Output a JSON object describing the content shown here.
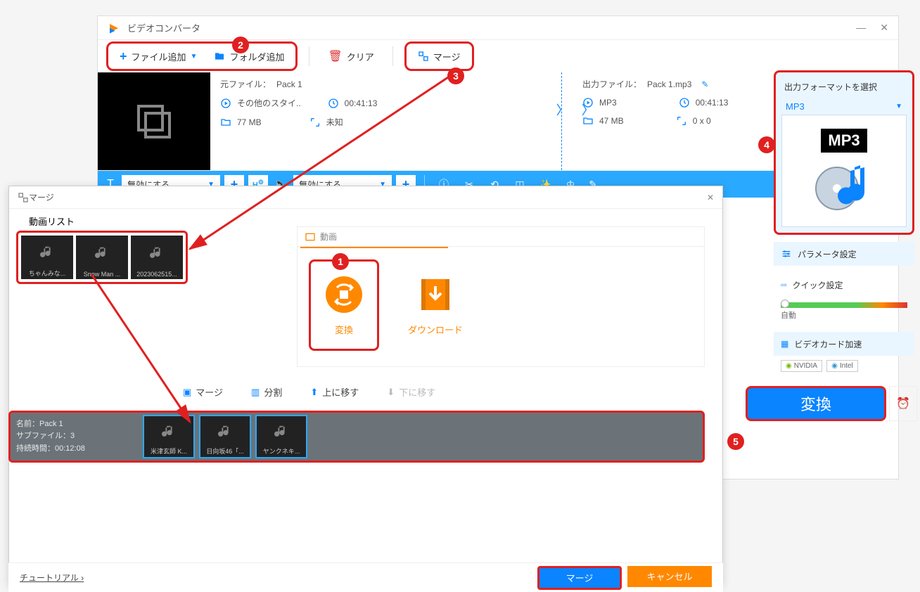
{
  "app": {
    "title": "ビデオコンバータ"
  },
  "toolbar": {
    "add_file": "ファイル追加",
    "add_folder": "フォルダ追加",
    "clear": "クリア",
    "merge": "マージ"
  },
  "source": {
    "label": "元ファイル：",
    "name": "Pack 1",
    "style": "その他のスタイ..",
    "duration": "00:41:13",
    "size": "77 MB",
    "resolution": "未知"
  },
  "output": {
    "label": "出力ファイル：",
    "name": "Pack 1.mp3",
    "format": "MP3",
    "duration": "00:41:13",
    "size": "47 MB",
    "resolution": "0 x 0"
  },
  "options_bar": {
    "subtitle_combo": "無効にする",
    "audio_combo": "無効にする"
  },
  "sidebar": {
    "select_format_title": "出力フォーマットを選択",
    "format": "MP3",
    "format_badge": "MP3",
    "param_settings": "パラメータ設定",
    "quick_settings": "クイック設定",
    "slider_label": "自動",
    "gpu_accel": "ビデオカード加速",
    "gpu1": "NVIDIA",
    "gpu2": "Intel",
    "convert": "変換"
  },
  "merge_dialog": {
    "title": "マージ",
    "video_list_label": "動画リスト",
    "source_items": [
      "ちゃんみな...",
      "Snow Man ...",
      "2023062515..."
    ],
    "center_header": "動画",
    "convert_tile": "変換",
    "download_tile": "ダウンロード",
    "tool_merge": "マージ",
    "tool_split": "分割",
    "tool_up": "上に移す",
    "tool_down": "下に移す",
    "pack": {
      "name_label": "名前：",
      "name": "Pack 1",
      "sub_label": "サブファイル：",
      "sub_count": "3",
      "duration_label": "持続時間：",
      "duration": "00:12:08",
      "items": [
        "米津玄師 K...",
        "日向坂46「...",
        "ヤンクネキ..."
      ]
    },
    "tutorial": "チュートリアル ›",
    "merge_btn": "マージ",
    "cancel_btn": "キャンセル"
  },
  "badges": {
    "b1": "1",
    "b2": "2",
    "b3": "3",
    "b4": "4",
    "b5": "5"
  }
}
